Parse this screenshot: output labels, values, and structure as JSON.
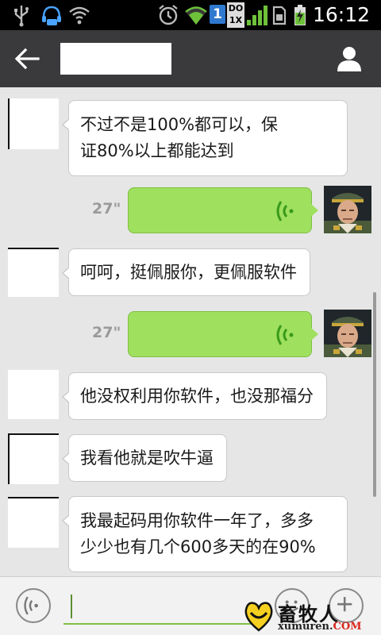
{
  "status_bar": {
    "time": "16:12",
    "sim_label": "1",
    "data_label_top": "DO",
    "data_label_bottom": "1X",
    "icons": [
      "usb-icon",
      "headset-icon",
      "wifi-hotspot-icon",
      "alarm-icon",
      "wifi-icon",
      "sim-icon",
      "signal-icon",
      "sd-card-icon",
      "battery-charging-icon"
    ]
  },
  "header": {
    "back_icon": "back-arrow-icon",
    "title": "",
    "profile_icon": "person-icon"
  },
  "messages": [
    {
      "side": "left",
      "type": "text",
      "lines": [
        "不过不是100%都可以，保",
        "证80%以上都能达到"
      ]
    },
    {
      "side": "right",
      "type": "voice",
      "duration": "27\""
    },
    {
      "side": "left",
      "type": "text",
      "lines": [
        "呵呵，挺佩服你，更佩服软件"
      ]
    },
    {
      "side": "right",
      "type": "voice",
      "duration": "27\""
    },
    {
      "side": "left",
      "type": "text",
      "lines": [
        "他没权利用你软件，也没那福分"
      ]
    },
    {
      "side": "left",
      "type": "text",
      "lines": [
        "我看他就是吹牛逼"
      ]
    },
    {
      "side": "left",
      "type": "text",
      "lines": [
        "我最起码用你软件一年了，多多",
        "少少也有几个600多天的在90%"
      ]
    }
  ],
  "input_bar": {
    "voice_icon": "voice-mode-icon",
    "input_value": "",
    "emoji_icon": "emoji-icon",
    "plus_icon": "plus-icon"
  },
  "watermark": {
    "text": "畜牧人",
    "url_main": "xumuren.",
    "url_tld": "COM"
  },
  "colors": {
    "header_bg": "#3a3a3c",
    "chat_bg": "#e6e6e6",
    "voice_bubble": "#9fe05f",
    "text_bubble": "#ffffff"
  }
}
